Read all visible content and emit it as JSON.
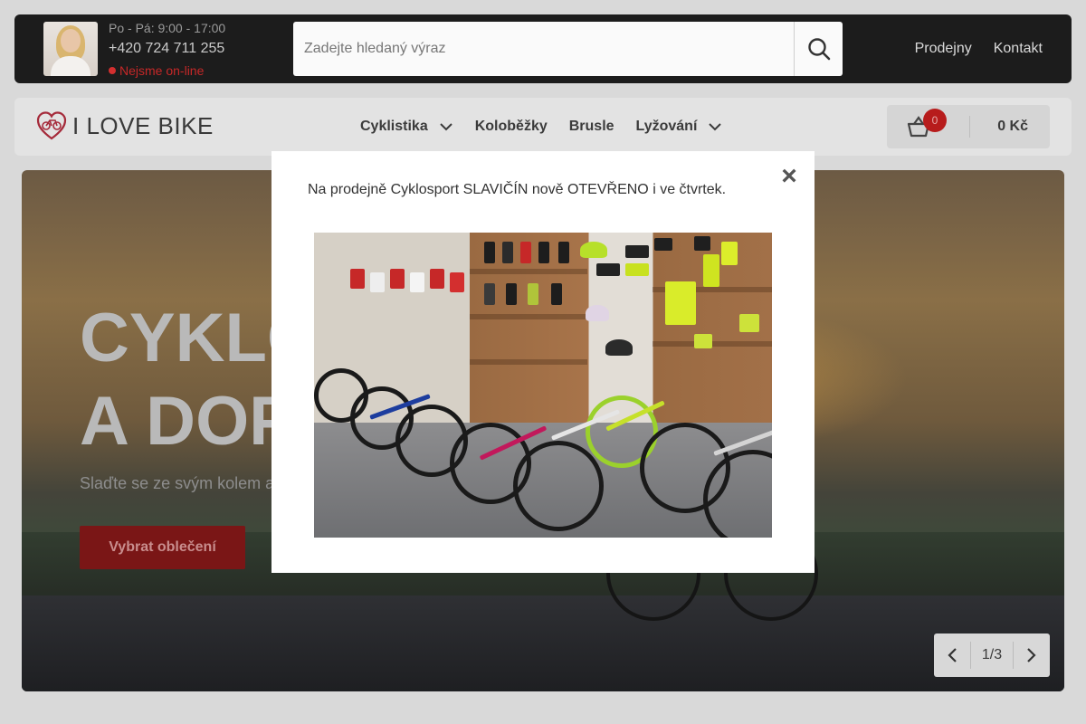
{
  "topbar": {
    "hours": "Po - Pá: 9:00 - 17:00",
    "phone": "+420 724 711 255",
    "status": "Nejsme on-line",
    "search_placeholder": "Zadejte hledaný výraz",
    "links": [
      "Prodejny",
      "Kontakt"
    ]
  },
  "navbar": {
    "logo_text": "I LOVE BIKE",
    "menu": [
      {
        "label": "Cyklistika",
        "has_dropdown": true
      },
      {
        "label": "Koloběžky",
        "has_dropdown": false
      },
      {
        "label": "Brusle",
        "has_dropdown": false
      },
      {
        "label": "Lyžování",
        "has_dropdown": true
      }
    ],
    "cart_count": "0",
    "cart_total": "0 Kč"
  },
  "hero": {
    "headline_line1": "CYKLO",
    "headline_line2": "A DOPL",
    "subline": "Slaďte se ze svým kolem a",
    "cta": "Vybrat oblečení",
    "pager": "1/3"
  },
  "modal": {
    "message": "Na prodejně Cyklosport SLAVIČÍN nově OTEVŘENO i ve čtvrtek.",
    "close_symbol": "×"
  },
  "colors": {
    "brand_red": "#b71c1c",
    "topbar_bg": "#1c1c1c",
    "navbar_bg": "#e3e3e3"
  }
}
